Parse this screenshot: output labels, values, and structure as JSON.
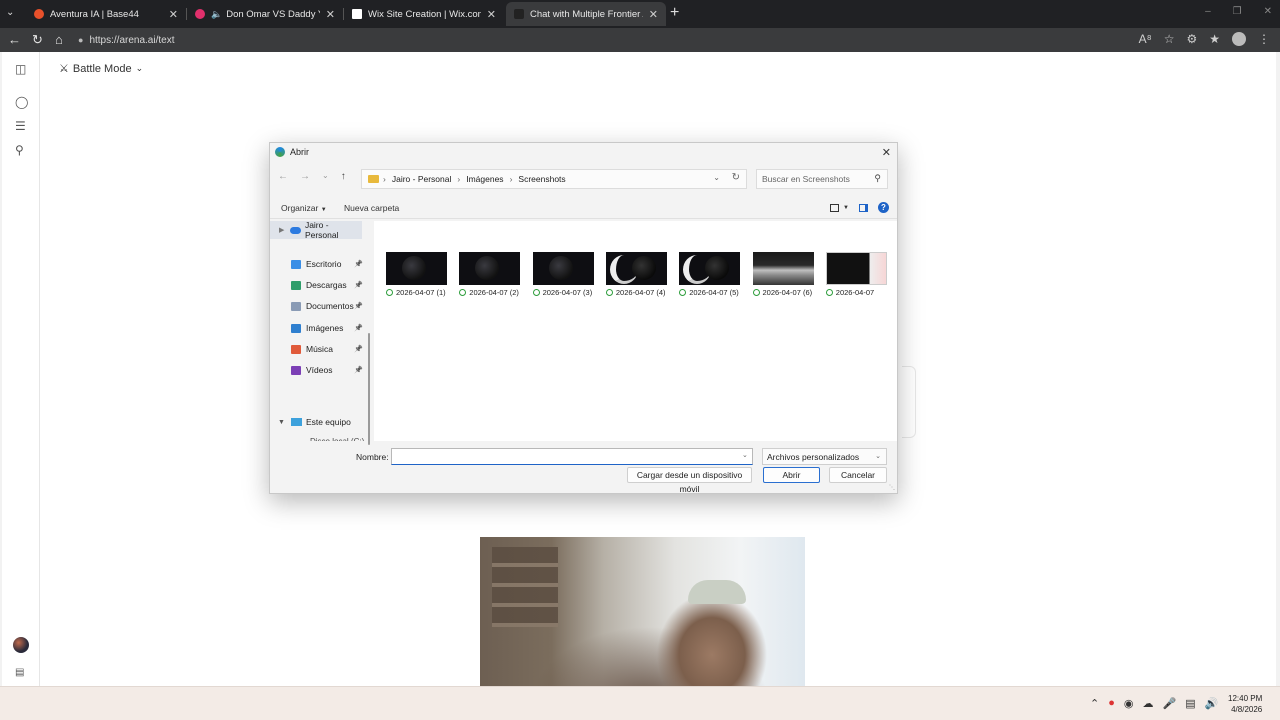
{
  "browser": {
    "tabs": [
      {
        "title": "Aventura IA | Base44",
        "favicon_color": "#e8512b"
      },
      {
        "title": "Don Omar VS Daddy Yankee | ...",
        "favicon_color": "#e1306c"
      },
      {
        "title": "Wix Site Creation | Wix.com",
        "favicon_color": "#ffffff"
      },
      {
        "title": "Chat with Multiple Frontier AI Mo...",
        "favicon_color": "#222222"
      }
    ],
    "url": "https://arena.ai/text"
  },
  "page": {
    "mode_label": "Battle Mode"
  },
  "dialog": {
    "title": "Abrir",
    "breadcrumb": [
      "Jairo - Personal",
      "Imágenes",
      "Screenshots"
    ],
    "search_placeholder": "Buscar en Screenshots",
    "organize_label": "Organizar",
    "new_folder_label": "Nueva carpeta",
    "nav": {
      "cloud_label": "Jairo - Personal",
      "items": [
        {
          "label": "Escritorio",
          "color": "#3a8ee6"
        },
        {
          "label": "Descargas",
          "color": "#2e9d6a"
        },
        {
          "label": "Documentos",
          "color": "#8a9bb5"
        },
        {
          "label": "Imágenes",
          "color": "#2f7fcf"
        },
        {
          "label": "Música",
          "color": "#e05a3a"
        },
        {
          "label": "Vídeos",
          "color": "#7b3fb5"
        }
      ],
      "pc_label": "Este equipo",
      "cut_label": "Disco local (C:)"
    },
    "files": [
      {
        "name": "2026-04-07 (1)",
        "kind": "moon"
      },
      {
        "name": "2026-04-07 (2)",
        "kind": "moon"
      },
      {
        "name": "2026-04-07 (3)",
        "kind": "moon"
      },
      {
        "name": "2026-04-07 (4)",
        "kind": "white"
      },
      {
        "name": "2026-04-07 (5)",
        "kind": "white"
      },
      {
        "name": "2026-04-07 (6)",
        "kind": "photo"
      },
      {
        "name": "2026-04-07",
        "kind": "web"
      }
    ],
    "filename_label": "Nombre:",
    "filename_value": "",
    "filetype_value": "Archivos personalizados",
    "mobile_button": "Cargar desde un dispositivo móvil",
    "open_button": "Abrir",
    "cancel_button": "Cancelar"
  },
  "taskbar": {
    "time": "12:40 PM",
    "date": "4/8/2026"
  }
}
